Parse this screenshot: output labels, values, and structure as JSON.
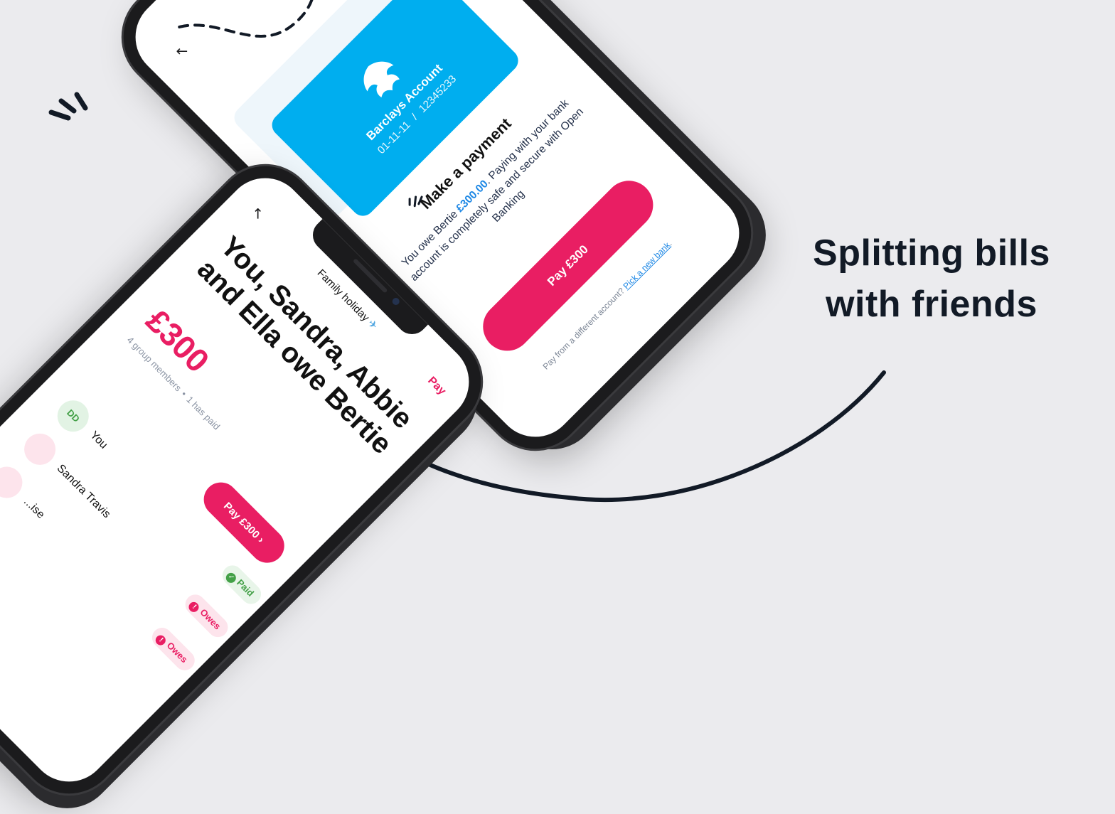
{
  "headline": {
    "line1": "Splitting bills",
    "line2": "with friends"
  },
  "payment_screen": {
    "bank": {
      "name": "Barclays Account",
      "sort_code": "01-11-11",
      "separator": "/",
      "account_number": "12345233"
    },
    "title": "Make a payment",
    "description_prefix": "You owe Bertie ",
    "amount": "£300.00",
    "description_suffix": ". Paying with your bank account is completely safe and secure with Open Banking",
    "pay_button": "Pay £300",
    "alt_prompt": "Pay from a different account?",
    "alt_link": "Pick a new bank",
    "alt_end": "."
  },
  "group_screen": {
    "group_name": "Family holiday",
    "group_icon": "airplane-icon",
    "header_action": "Pay",
    "title": "You, Sandra, Abbie and Ella owe Bertie",
    "amount": "£300",
    "members_count": "4 group members",
    "paid_count": "1 has paid",
    "pay_button": "Pay £300",
    "members": [
      {
        "initials": "DD",
        "name": "You",
        "status": "Paid"
      },
      {
        "initials": "",
        "name": "Sandra Travis",
        "status": "Owes"
      },
      {
        "initials": "",
        "name": "...ise",
        "status": "Owes"
      }
    ]
  },
  "colors": {
    "accent": "#e91e63",
    "bank_blue": "#00aeef",
    "link": "#1e88e5",
    "paid_green": "#43a047",
    "background": "#ebebee"
  }
}
